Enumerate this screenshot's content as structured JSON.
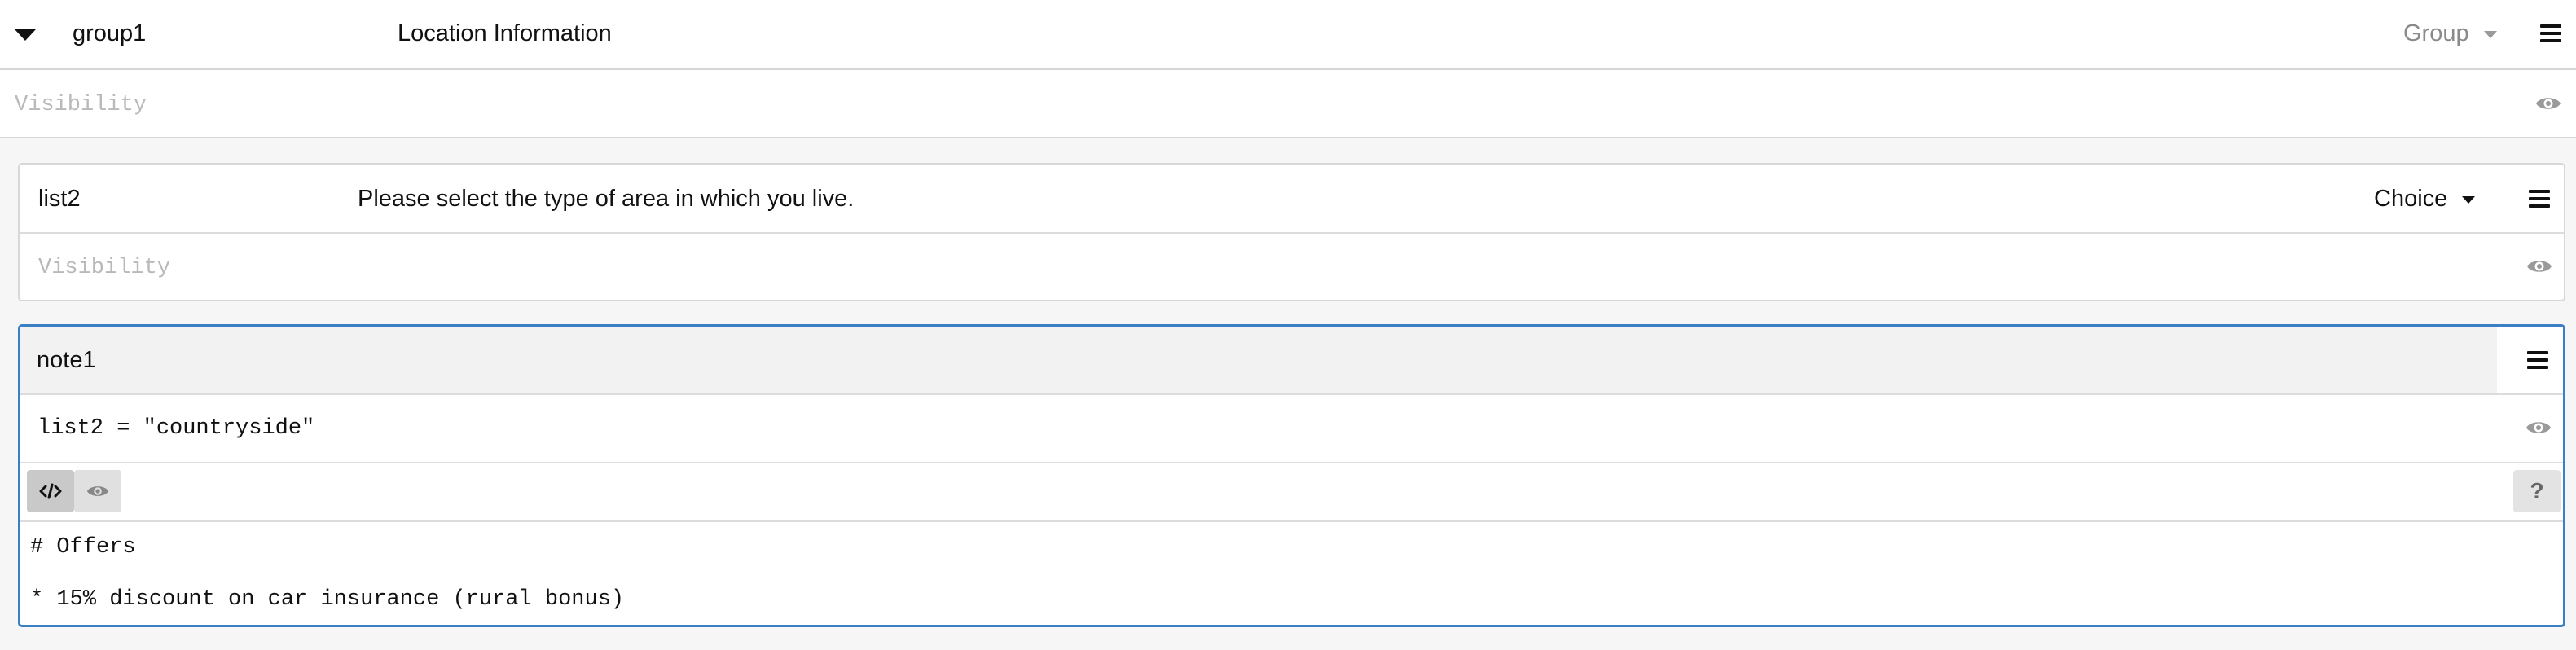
{
  "group": {
    "id": "group1",
    "label": "Location Information",
    "type": "Group",
    "visibility_placeholder": "Visibility"
  },
  "list": {
    "id": "list2",
    "label": "Please select the type of area in which you live.",
    "type": "Choice",
    "visibility_placeholder": "Visibility"
  },
  "note": {
    "id": "note1",
    "visibility_value": "list2 = \"countryside\"",
    "editor_lines": [
      "# Offers",
      "",
      "* 15% discount on car insurance (rural bonus)"
    ],
    "help_label": "?"
  },
  "icons": {
    "collapse": "chevron-down-icon",
    "menu": "hamburger-menu-icon",
    "visibility": "eye-icon",
    "code": "code-icon",
    "preview": "eye-icon"
  },
  "colors": {
    "focus_border": "#3b7fc4",
    "placeholder": "#b9b9b9",
    "muted": "#8a8a8a"
  }
}
